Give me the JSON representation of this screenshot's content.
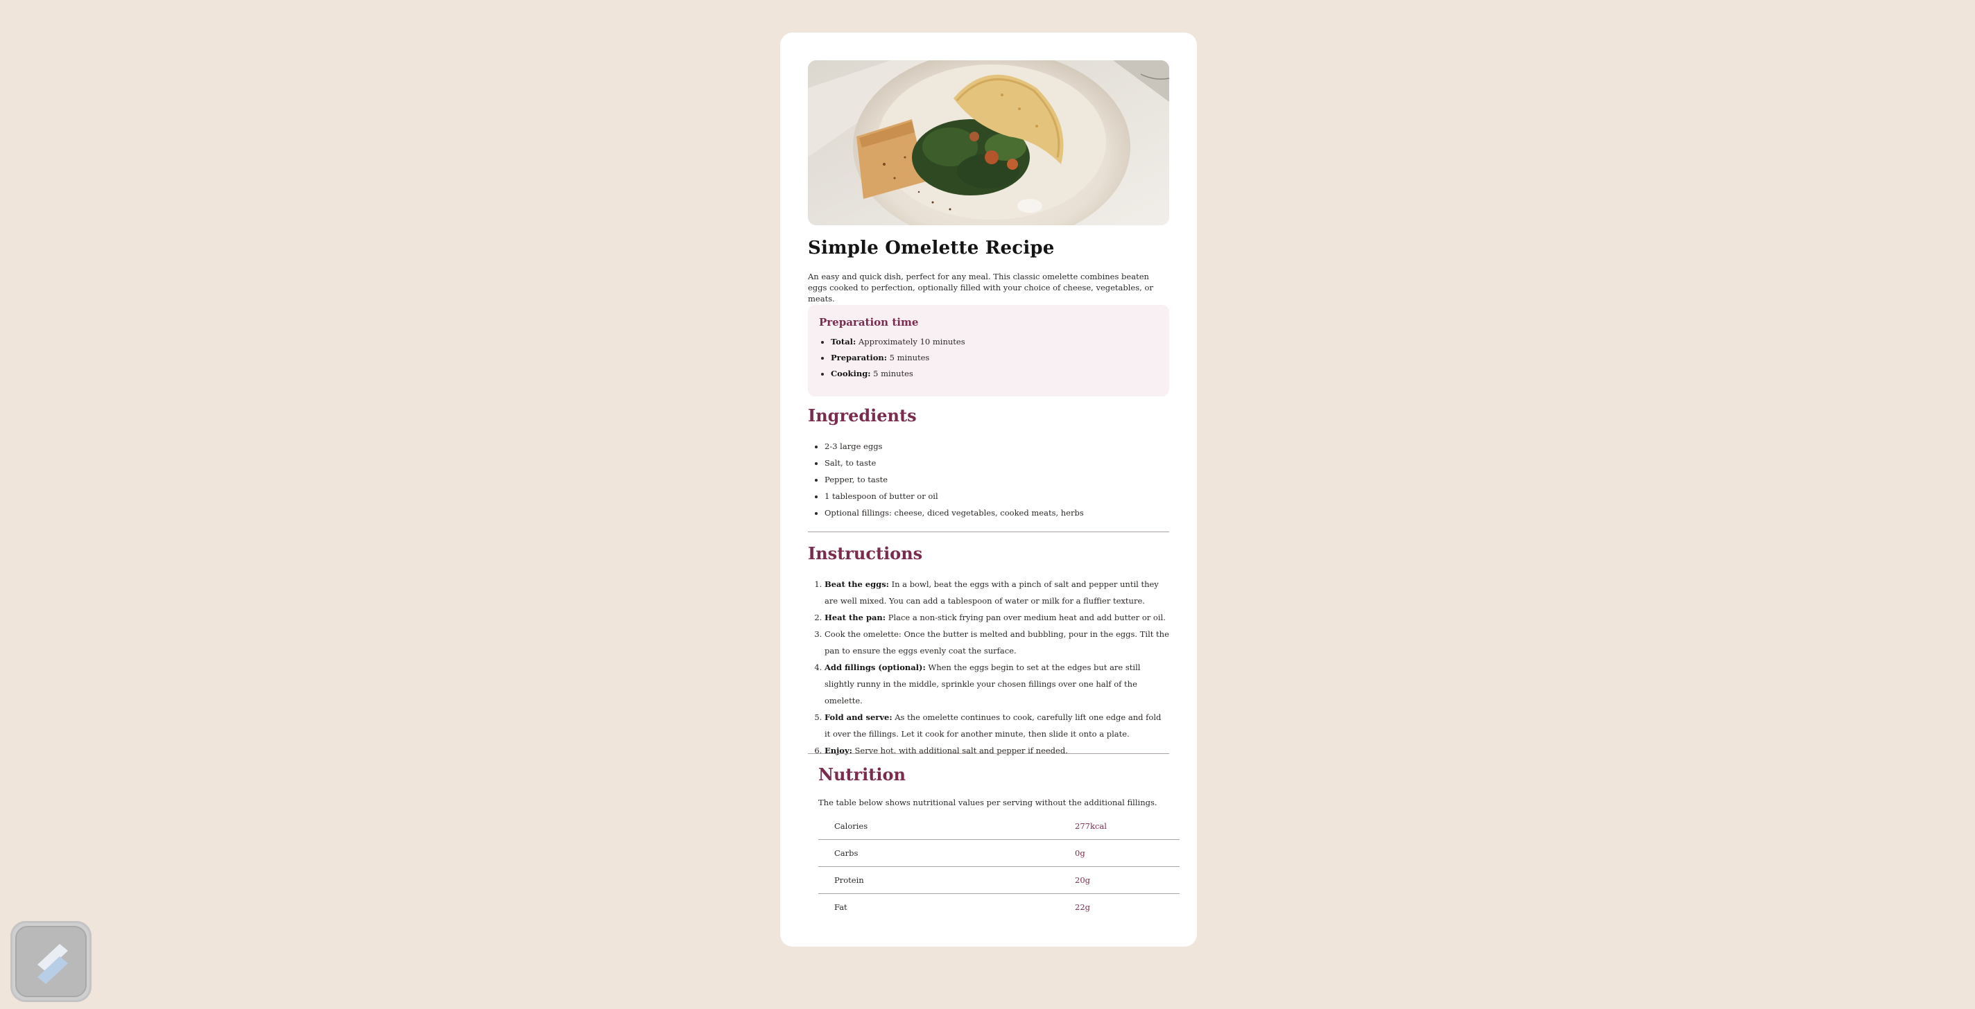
{
  "recipe": {
    "title": "Simple Omelette Recipe",
    "intro": "An easy and quick dish, perfect for any meal. This classic omelette combines beaten eggs cooked to perfection, optionally filled with your choice of cheese, vegetables, or meats."
  },
  "prep": {
    "heading": "Preparation time",
    "items": [
      {
        "label": "Total:",
        "value": "Approximately 10 minutes"
      },
      {
        "label": "Preparation:",
        "value": "5 minutes"
      },
      {
        "label": "Cooking:",
        "value": "5 minutes"
      }
    ]
  },
  "ingredients": {
    "heading": "Ingredients",
    "items": [
      "2-3 large eggs",
      "Salt, to taste",
      "Pepper, to taste",
      "1 tablespoon of butter or oil",
      "Optional fillings: cheese, diced vegetables, cooked meats, herbs"
    ]
  },
  "instructions": {
    "heading": "Instructions",
    "steps": [
      {
        "label": "Beat the eggs:",
        "text": " In a bowl, beat the eggs with a pinch of salt and pepper until they are well mixed. You can add a tablespoon of water or milk for a fluffier texture."
      },
      {
        "label": "Heat the pan:",
        "text": " Place a non-stick frying pan over medium heat and add butter or oil."
      },
      {
        "label": "",
        "text": "Cook the omelette: Once the butter is melted and bubbling, pour in the eggs. Tilt the pan to ensure the eggs evenly coat the surface."
      },
      {
        "label": "Add fillings (optional):",
        "text": " When the eggs begin to set at the edges but are still slightly runny in the middle, sprinkle your chosen fillings over one half of the omelette."
      },
      {
        "label": "Fold and serve:",
        "text": " As the omelette continues to cook, carefully lift one edge and fold it over the fillings. Let it cook for another minute, then slide it onto a plate."
      },
      {
        "label": "Enjoy:",
        "text": " Serve hot, with additional salt and pepper if needed."
      }
    ]
  },
  "nutrition": {
    "heading": "Nutrition",
    "intro": "The table below shows nutritional values per serving without the additional fillings.",
    "rows": [
      {
        "name": "Calories",
        "value": "277kcal"
      },
      {
        "name": "Carbs",
        "value": "0g"
      },
      {
        "name": "Protein",
        "value": "20g"
      },
      {
        "name": "Fat",
        "value": "22g"
      }
    ]
  },
  "colors": {
    "page_bg": "#efe5da",
    "accent": "#7a2c4e",
    "prep_bg": "#f9f0f4"
  },
  "icons": {
    "hero": "omelette-photo",
    "badge": "app-logo-icon"
  }
}
